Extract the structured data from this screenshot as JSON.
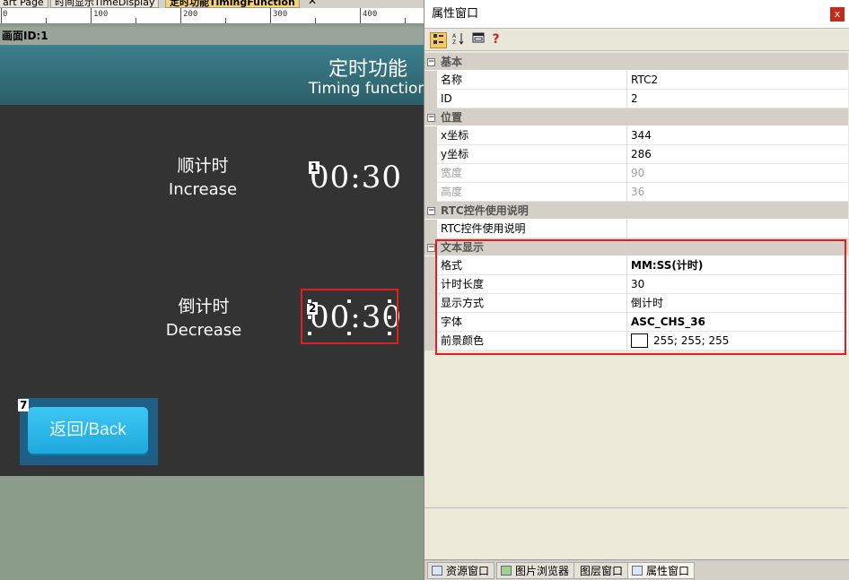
{
  "tabs": [
    {
      "label": "art Page"
    },
    {
      "label": "时间显示TimeDisplay"
    },
    {
      "label": "定时功能TimingFunction",
      "active": true
    }
  ],
  "ruler": {
    "ticks": [
      "0",
      "100",
      "200",
      "300",
      "400"
    ]
  },
  "canvas": {
    "screen_id_label": "画面ID:1"
  },
  "screen": {
    "title_cn": "定时功能",
    "title_en": "Timing function",
    "increase": {
      "cn": "顺计时",
      "en": "Increase",
      "time": "00:30",
      "id": "1"
    },
    "decrease": {
      "cn": "倒计时",
      "en": "Decrease",
      "time": "00:30",
      "id": "2"
    },
    "back": {
      "label": "返回/Back",
      "id": "7"
    }
  },
  "props": {
    "title": "属性窗口",
    "close": "x",
    "toolbar": {
      "categorized_icon": "categorized-icon",
      "sort_icon": "sort-az-icon",
      "pages_icon": "property-pages-icon",
      "help_icon": "help-icon"
    },
    "categories": [
      {
        "name": "基本",
        "rows": [
          {
            "key": "名称",
            "value": "RTC2"
          },
          {
            "key": "ID",
            "value": "2"
          }
        ]
      },
      {
        "name": "位置",
        "rows": [
          {
            "key": "x坐标",
            "value": "344"
          },
          {
            "key": "y坐标",
            "value": "286"
          },
          {
            "key": "宽度",
            "value": "90",
            "disabled": true
          },
          {
            "key": "高度",
            "value": "36",
            "disabled": true
          }
        ]
      },
      {
        "name": "RTC控件使用说明",
        "rows": [
          {
            "key": "RTC控件使用说明",
            "value": ""
          }
        ]
      },
      {
        "name": "文本显示",
        "rows": [
          {
            "key": "格式",
            "value": "MM:SS(计时)",
            "bold": true
          },
          {
            "key": "计时长度",
            "value": "30"
          },
          {
            "key": "显示方式",
            "value": "倒计时"
          },
          {
            "key": "字体",
            "value": "ASC_CHS_36",
            "bold": true
          },
          {
            "key": "前景颜色",
            "value": "255; 255; 255",
            "swatch": "#ffffff"
          }
        ]
      }
    ]
  },
  "bottom_tabs": [
    {
      "label": "资源窗口"
    },
    {
      "label": "图片浏览器"
    },
    {
      "label": "图层窗口"
    },
    {
      "label": "属性窗口",
      "active": true
    }
  ],
  "colors": {
    "accent_selection": "#e02020",
    "header_teal": "#3c7f8c",
    "button_blue": "#1ea8de",
    "screen_bg": "#333333"
  }
}
